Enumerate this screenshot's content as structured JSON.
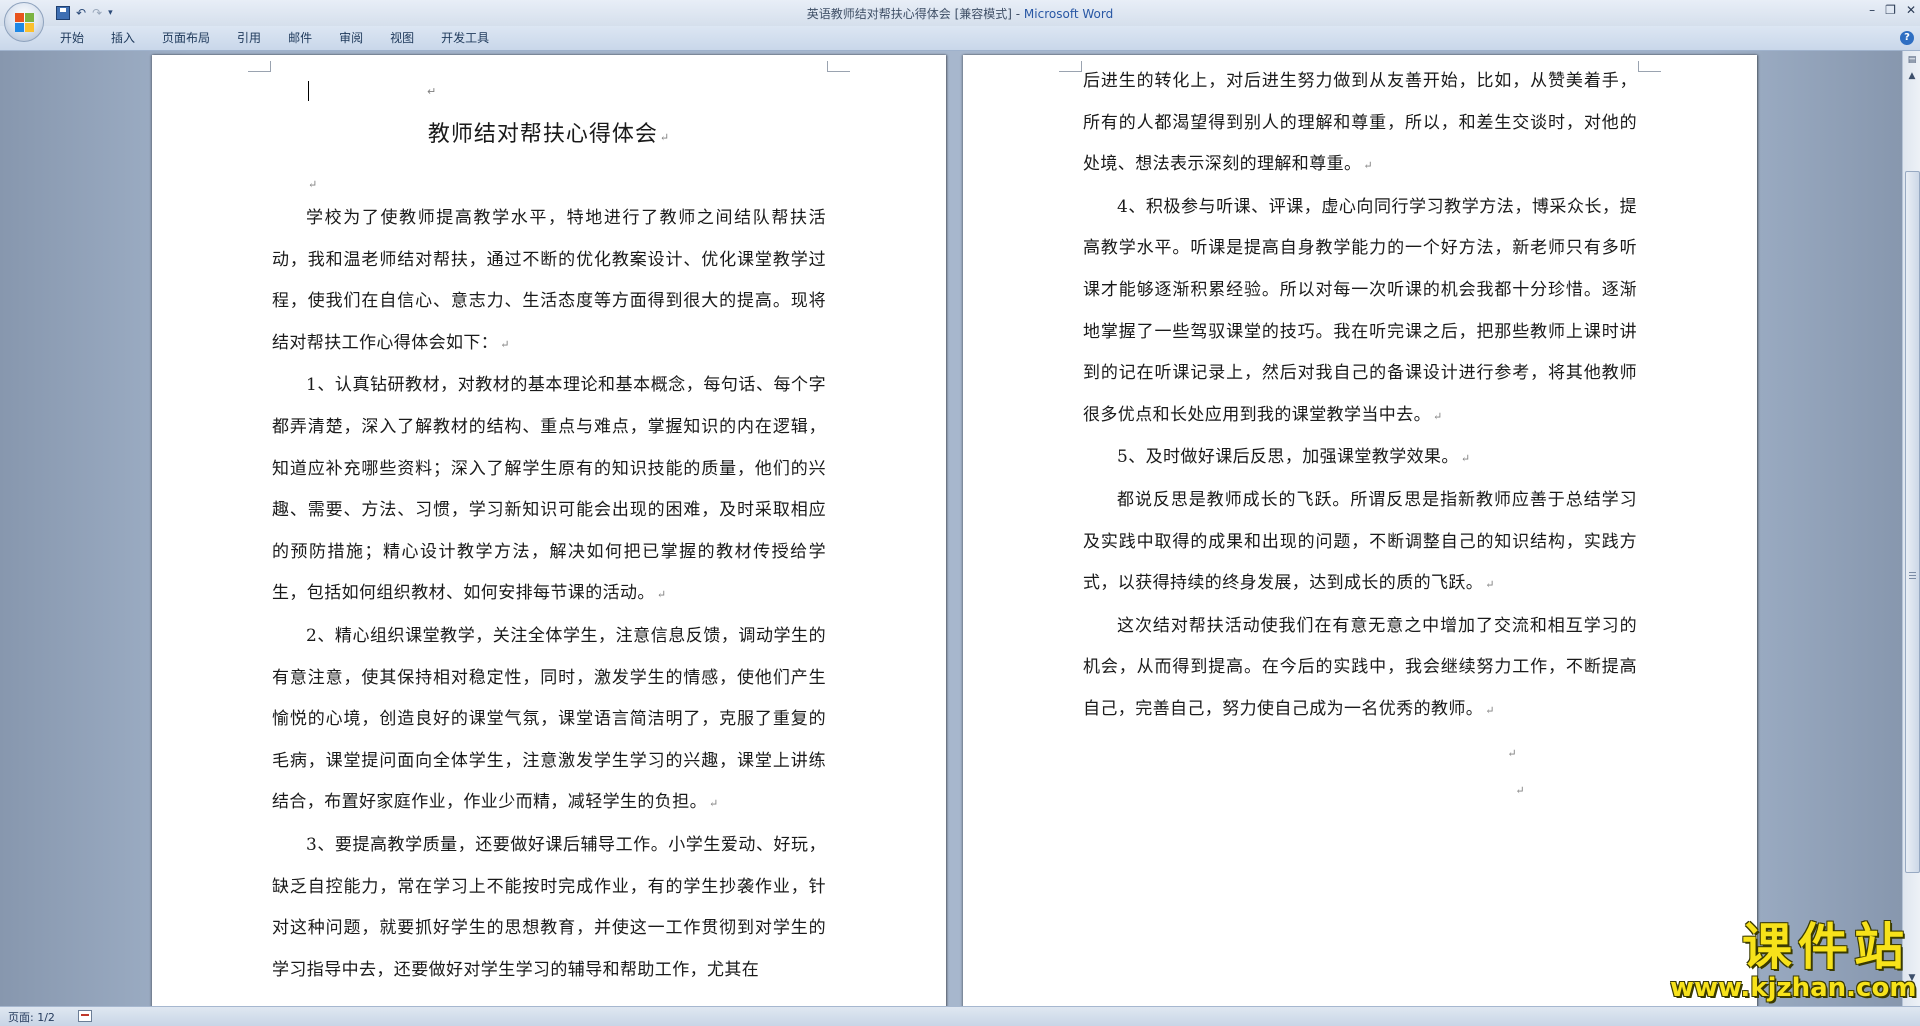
{
  "window": {
    "doc_title": "英语教师结对帮扶心得体会 [兼容模式] - ",
    "app_name": "Microsoft Word",
    "minimize": "–",
    "restore": "❐",
    "close": "✕"
  },
  "qat": {
    "undo": "↶",
    "redo": "↷",
    "more": "▾"
  },
  "ribbon": {
    "tabs": [
      "开始",
      "插入",
      "页面布局",
      "引用",
      "邮件",
      "审阅",
      "视图",
      "开发工具"
    ],
    "help": "?"
  },
  "document": {
    "title": "教师结对帮扶心得体会",
    "para_mark": "↵",
    "page1_paragraphs": [
      "学校为了使教师提高教学水平，特地进行了教师之间结队帮扶活动，我和温老师结对帮扶，通过不断的优化教案设计、优化课堂教学过程，使我们在自信心、意志力、生活态度等方面得到很大的提高。现将结对帮扶工作心得体会如下：",
      "1、认真钻研教材，对教材的基本理论和基本概念，每句话、每个字都弄清楚，深入了解教材的结构、重点与难点，掌握知识的内在逻辑，知道应补充哪些资料；深入了解学生原有的知识技能的质量，他们的兴趣、需要、方法、习惯，学习新知识可能会出现的困难，及时采取相应的预防措施；精心设计教学方法，解决如何把已掌握的教材传授给学生，包括如何组织教材、如何安排每节课的活动。",
      "2、精心组织课堂教学，关注全体学生，注意信息反馈，调动学生的有意注意，使其保持相对稳定性，同时，激发学生的情感，使他们产生愉悦的心境，创造良好的课堂气氛，课堂语言简洁明了，克服了重复的毛病，课堂提问面向全体学生，注意激发学生学习的兴趣，课堂上讲练结合，布置好家庭作业，作业少而精，减轻学生的负担。",
      "3、要提高教学质量，还要做好课后辅导工作。小学生爱动、好玩，缺乏自控能力，常在学习上不能按时完成作业，有的学生抄袭作业，针对这种问题，就要抓好学生的思想教育，并使这一工作贯彻到对学生的学习指导中去，还要做好对学生学习的辅导和帮助工作，尤其在"
    ],
    "page2_paragraphs": [
      "后进生的转化上，对后进生努力做到从友善开始，比如，从赞美着手，所有的人都渴望得到别人的理解和尊重，所以，和差生交谈时，对他的处境、想法表示深刻的理解和尊重。",
      "4、积极参与听课、评课，虚心向同行学习教学方法，博采众长，提高教学水平。听课是提高自身教学能力的一个好方法，新老师只有多听课才能够逐渐积累经验。所以对每一次听课的机会我都十分珍惜。逐渐地掌握了一些驾驭课堂的技巧。我在听完课之后，把那些教师上课时讲到的记在听课记录上，然后对我自己的备课设计进行参考，将其他教师很多优点和长处应用到我的课堂教学当中去。",
      "5、及时做好课后反思，加强课堂教学效果。",
      "都说反思是教师成长的飞跃。所谓反思是指新教师应善于总结学习及实践中取得的成果和出现的问题，不断调整自己的知识结构，实践方式，以获得持续的终身发展，达到成长的质的飞跃。",
      "这次结对帮扶活动使我们在有意无意之中增加了交流和相互学习的机会，从而得到提高。在今后的实践中，我会继续努力工作，不断提高自己，完善自己，努力使自己成为一名优秀的教师。"
    ]
  },
  "statusbar": {
    "page_info": "页面: 1/2"
  },
  "watermark": {
    "name": "课件站",
    "url": "www.kjzhan.com"
  },
  "colors": {
    "accent": "#2857a4",
    "watermark": "#f7e21a"
  }
}
